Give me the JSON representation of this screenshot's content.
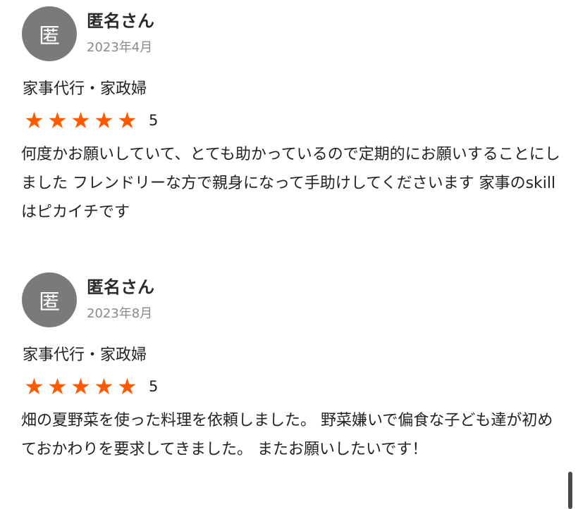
{
  "reviews": [
    {
      "avatar_char": "匿",
      "name": "匿名さん",
      "date": "2023年4月",
      "category": "家事代行・家政婦",
      "rating": 5,
      "rating_label": "5",
      "text": "何度かお願いしていて、とても助かっているので定期的にお願いすることにしました フレンドリーな方で親身になって手助けしてくださいます 家事のskillはピカイチです"
    },
    {
      "avatar_char": "匿",
      "name": "匿名さん",
      "date": "2023年8月",
      "category": "家事代行・家政婦",
      "rating": 5,
      "rating_label": "5",
      "text": "畑の夏野菜を使った料理を依頼しました。 野菜嫌いで偏食な子ども達が初めておかわりを要求してきました。 またお願いしたいです！"
    }
  ],
  "colors": {
    "star": "#ff5a00",
    "avatar_bg": "#7a7a7a",
    "date": "#8a8a8a"
  },
  "icons": {
    "star": "star-icon"
  }
}
